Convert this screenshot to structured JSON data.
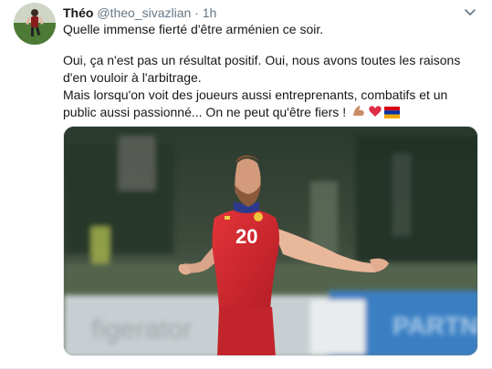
{
  "tweet": {
    "display_name": "Théo",
    "handle": "@theo_sivazlian",
    "separator": "·",
    "time": "1h",
    "line1": "Quelle immense fierté d'être arménien ce soir.",
    "line2": "Oui, ça n'est pas un résultat positif. Oui, nous avons toutes les raisons d'en vouloir à l'arbitrage.",
    "line3": "Mais lorsqu'on voit des joueurs aussi entreprenants, combatifs et un public aussi passionné... On ne peut qu'être fiers !",
    "emojis": [
      "flexed-biceps-icon",
      "red-heart-icon",
      "armenia-flag-icon"
    ]
  },
  "media": {
    "jersey_number": "20",
    "banner_left": "figerator",
    "banner_right": "PARTN"
  },
  "colors": {
    "text": "#14171a",
    "meta": "#657786",
    "jersey": "#d8262e",
    "armenia_red": "#d90012",
    "armenia_blue": "#0033a0",
    "armenia_orange": "#f2a800"
  }
}
